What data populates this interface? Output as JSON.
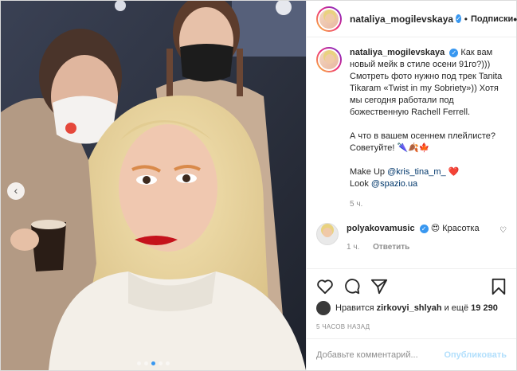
{
  "header": {
    "username": "nataliya_mogilevskaya",
    "follow_label": "Подписки",
    "more_label": "•••"
  },
  "caption": {
    "username": "nataliya_mogilevskaya",
    "text_1": "Как вам новый мейк в стиле осени 91го?))) Смотреть фото нужно под трек Tanita Tikaram «Twist in my Sobriety»)) Хотя мы сегодня работали под божественную Rachell Ferrell.",
    "text_2": "А что в вашем осеннем плейлисте? Советуйте! 🌂🍂🍁",
    "makeup_label": "Make Up",
    "makeup_handle": "@kris_tina_m_",
    "makeup_emoji": "❤️",
    "look_label": "Look",
    "look_handle": "@spazio.ua",
    "time": "5 ч."
  },
  "comment": {
    "username": "polyakovamusic",
    "emoji": "😍",
    "text": "Красотка",
    "time": "1 ч.",
    "reply_label": "Ответить"
  },
  "likes": {
    "prefix": "Нравится",
    "liker": "zirkovyi_shlyah",
    "suffix": "и ещё",
    "count": "19 290"
  },
  "posted_ago": "5 ЧАСОВ НАЗАД",
  "add_comment": {
    "placeholder": "Добавьте комментарий...",
    "publish_label": "Опубликовать"
  },
  "carousel": {
    "prev_label": "‹",
    "total": 5,
    "active": 3
  }
}
